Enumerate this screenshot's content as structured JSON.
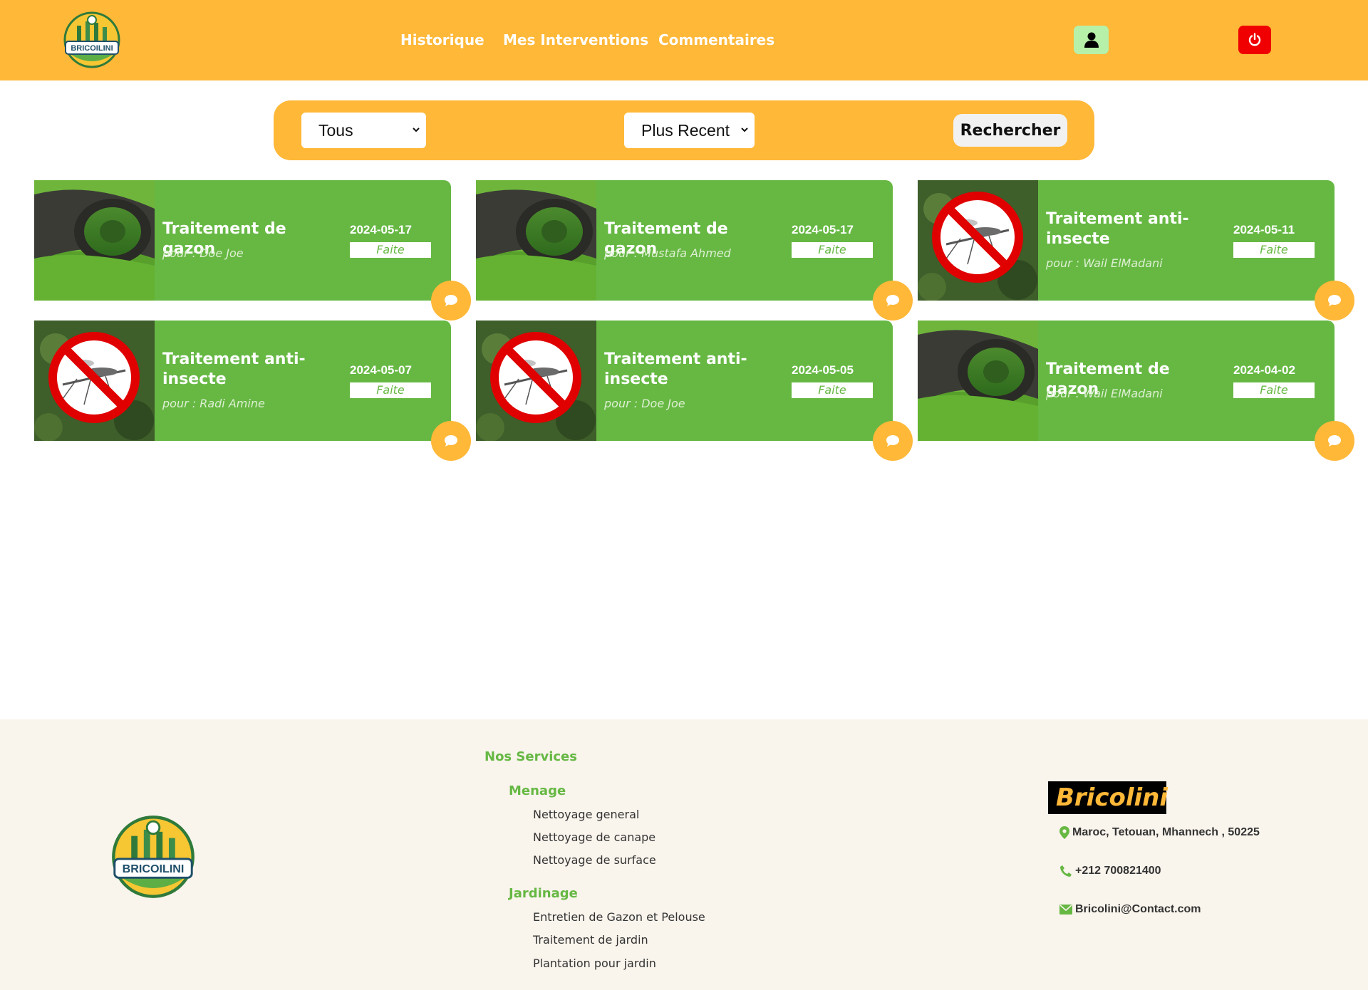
{
  "header": {
    "logo_text": "BRICOILINI",
    "nav": [
      "Historique",
      "Mes Interventions",
      "Commentaires"
    ],
    "icons": {
      "user": "user-icon",
      "power": "power-icon"
    },
    "colors": {
      "bar": "#FFB838",
      "user_bg": "#B7F0A8",
      "power_bg": "#F00000"
    }
  },
  "filters": {
    "type_value": "Tous",
    "sort_value": "Plus Recent",
    "search_label": "Rechercher"
  },
  "cards": [
    {
      "title": "Traitement de gazon",
      "who": "pour : Doe Joe",
      "date": "2024-05-17",
      "status": "Faite",
      "image": "lawn-roll"
    },
    {
      "title": "Traitement de gazon",
      "who": "pour : Mustafa Ahmed",
      "date": "2024-05-17",
      "status": "Faite",
      "image": "lawn-roll"
    },
    {
      "title": "Traitement anti-insecte",
      "who": "pour : Wail ElMadani",
      "date": "2024-05-11",
      "status": "Faite",
      "image": "no-mosquito"
    },
    {
      "title": "Traitement anti-insecte",
      "who": "pour : Radi Amine",
      "date": "2024-05-07",
      "status": "Faite",
      "image": "no-mosquito"
    },
    {
      "title": "Traitement anti-insecte",
      "who": "pour : Doe Joe",
      "date": "2024-05-05",
      "status": "Faite",
      "image": "no-mosquito"
    },
    {
      "title": "Traitement de gazon",
      "who": "pour : Wail ElMadani",
      "date": "2024-04-02",
      "status": "Faite",
      "image": "lawn-roll"
    }
  ],
  "footer": {
    "logo_text": "BRICOILINI",
    "services_heading": "Nos Services",
    "categories": [
      {
        "name": "Menage",
        "items": [
          "Nettoyage general",
          "Nettoyage de canape",
          "Nettoyage de surface"
        ]
      },
      {
        "name": "Jardinage",
        "items": [
          "Entretien de Gazon et Pelouse",
          "Traitement de jardin",
          "Plantation pour jardin"
        ]
      }
    ],
    "brand": "Bricolini",
    "address": "Maroc, Tetouan, Mhannech , 50225",
    "phone": "+212 700821400",
    "email": "Bricolini@Contact.com",
    "colors": {
      "bg": "#F9F4EC",
      "green": "#66B843",
      "brand_text": "#FFB838"
    }
  }
}
